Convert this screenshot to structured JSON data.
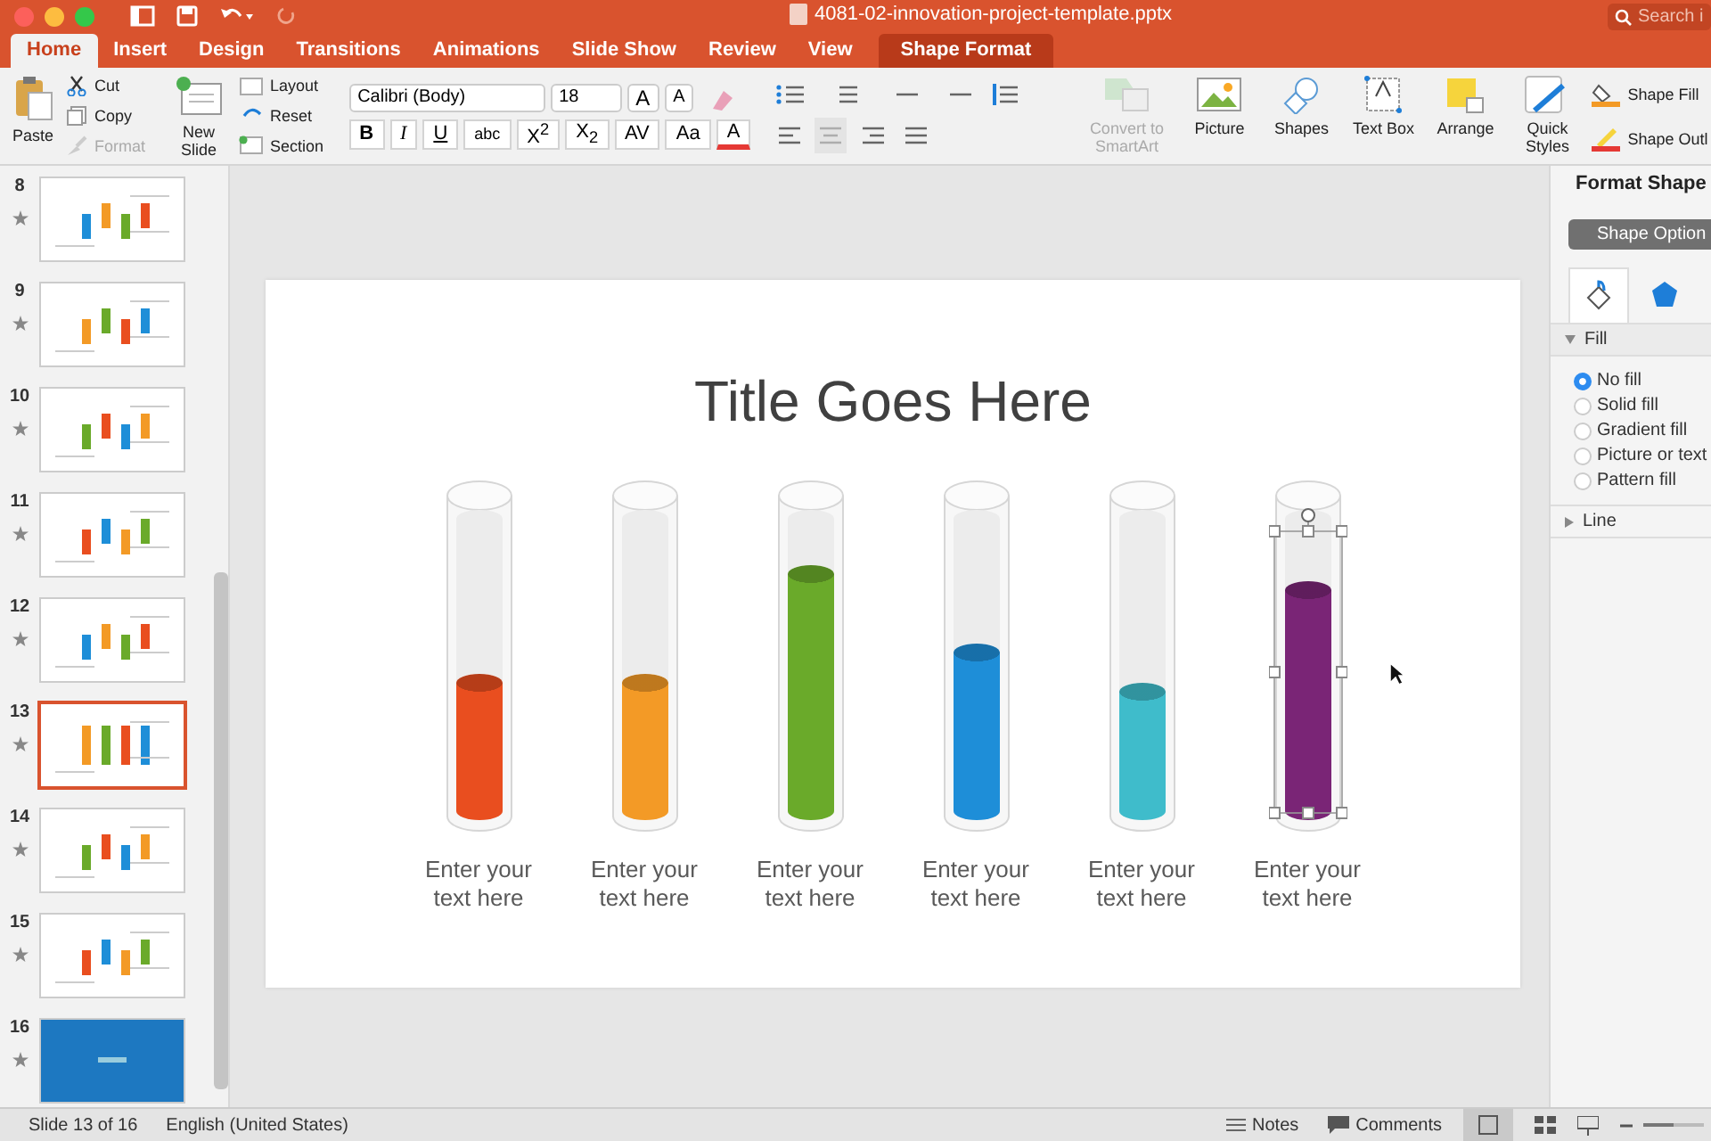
{
  "window": {
    "title": "4081-02-innovation-project-template.pptx"
  },
  "search": {
    "placeholder": "Search i"
  },
  "tabs": [
    {
      "label": "Home",
      "selected": true,
      "kind": "standard"
    },
    {
      "label": "Insert",
      "selected": false,
      "kind": "standard"
    },
    {
      "label": "Design",
      "selected": false,
      "kind": "standard"
    },
    {
      "label": "Transitions",
      "selected": false,
      "kind": "standard"
    },
    {
      "label": "Animations",
      "selected": false,
      "kind": "standard"
    },
    {
      "label": "Slide Show",
      "selected": false,
      "kind": "standard"
    },
    {
      "label": "Review",
      "selected": false,
      "kind": "standard"
    },
    {
      "label": "View",
      "selected": false,
      "kind": "standard"
    },
    {
      "label": "Shape Format",
      "selected": false,
      "kind": "contextual"
    }
  ],
  "ribbon": {
    "paste": "Paste",
    "clipboard": [
      {
        "label": "Cut",
        "kind": "cut",
        "disabled": false
      },
      {
        "label": "Copy",
        "kind": "copy",
        "disabled": false
      },
      {
        "label": "Format",
        "kind": "brush",
        "disabled": true
      }
    ],
    "new_slide": "New Slide",
    "slides": [
      {
        "label": "Layout",
        "kind": "layout"
      },
      {
        "label": "Reset",
        "kind": "reset"
      },
      {
        "label": "Section",
        "kind": "section"
      }
    ],
    "font_name": "Calibri (Body)",
    "font_size": "18",
    "grow": "A",
    "shrink": "A",
    "styles": [
      "B",
      "I",
      "U",
      "abc",
      "X$^{2}$",
      "X$_{2}$",
      "AV",
      "Aa"
    ],
    "font_color": "A",
    "insert": [
      {
        "label": "Convert to SmartArt",
        "kind": "smartart",
        "disabled": true
      },
      {
        "label": "Picture",
        "kind": "picture",
        "disabled": false
      },
      {
        "label": "Shapes",
        "kind": "shapes",
        "disabled": false
      },
      {
        "label": "Text Box",
        "kind": "textbox",
        "disabled": false
      },
      {
        "label": "Arrange",
        "kind": "arrange",
        "disabled": false
      },
      {
        "label": "Quick Styles",
        "kind": "styles",
        "disabled": false
      }
    ],
    "shape_fill": "Shape Fill",
    "shape_outline": "Shape Outl"
  },
  "slides": [
    {
      "number": "8",
      "selected": false,
      "kind": "diagram"
    },
    {
      "number": "9",
      "selected": false,
      "kind": "diagram"
    },
    {
      "number": "10",
      "selected": false,
      "kind": "diagram"
    },
    {
      "number": "11",
      "selected": false,
      "kind": "diagram"
    },
    {
      "number": "12",
      "selected": false,
      "kind": "diagram"
    },
    {
      "number": "13",
      "selected": true,
      "kind": "diagram"
    },
    {
      "number": "14",
      "selected": false,
      "kind": "diagram"
    },
    {
      "number": "15",
      "selected": false,
      "kind": "diagram"
    },
    {
      "number": "16",
      "selected": false,
      "kind": "cover"
    }
  ],
  "slide": {
    "title": "Title Goes Here",
    "tubes": [
      {
        "color": "#e94e1f",
        "level": 0.47,
        "label": "Enter your text here",
        "selected": false
      },
      {
        "color": "#f39a26",
        "level": 0.47,
        "label": "Enter your text here",
        "selected": false
      },
      {
        "color": "#6aaa2a",
        "level": 0.82,
        "label": "Enter your text here",
        "selected": false
      },
      {
        "color": "#1e8ed8",
        "level": 0.57,
        "label": "Enter your text here",
        "selected": false
      },
      {
        "color": "#3fbccb",
        "level": 0.44,
        "label": "Enter your text here",
        "selected": false
      },
      {
        "color": "#7a2576",
        "level": 0.77,
        "label": "Enter your text here",
        "selected": true
      }
    ]
  },
  "format_pane": {
    "title": "Format Shape",
    "options_button": "Shape Option",
    "fill": {
      "label": "Fill",
      "expanded": true,
      "options": [
        {
          "label": "No fill",
          "selected": true
        },
        {
          "label": "Solid fill",
          "selected": false
        },
        {
          "label": "Gradient fill",
          "selected": false
        },
        {
          "label": "Picture or text",
          "selected": false
        },
        {
          "label": "Pattern fill",
          "selected": false
        }
      ]
    },
    "line": {
      "label": "Line",
      "expanded": false
    }
  },
  "status_bar": {
    "slide": "Slide 13 of 16",
    "language": "English (United States)",
    "notes": "Notes",
    "comments": "Comments",
    "zoom": {
      "level": 0.5
    }
  }
}
